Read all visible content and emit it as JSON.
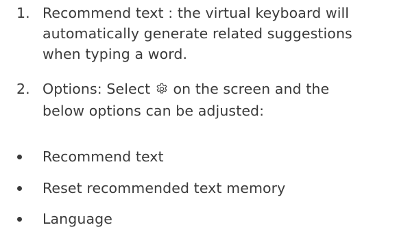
{
  "items": [
    {
      "marker": "1.",
      "lines": [
        "Recommend text : the virtual keyboard will",
        "automatically generate related suggestions",
        "when typing a word."
      ]
    },
    {
      "marker": "2.",
      "line1_before_icon": "Options: Select",
      "line1_after_icon": "on the screen and the",
      "line2": "below options can be adjusted:",
      "icon": "gear-icon"
    }
  ],
  "bullets": [
    "Recommend text",
    "Reset recommended text memory",
    "Language"
  ]
}
